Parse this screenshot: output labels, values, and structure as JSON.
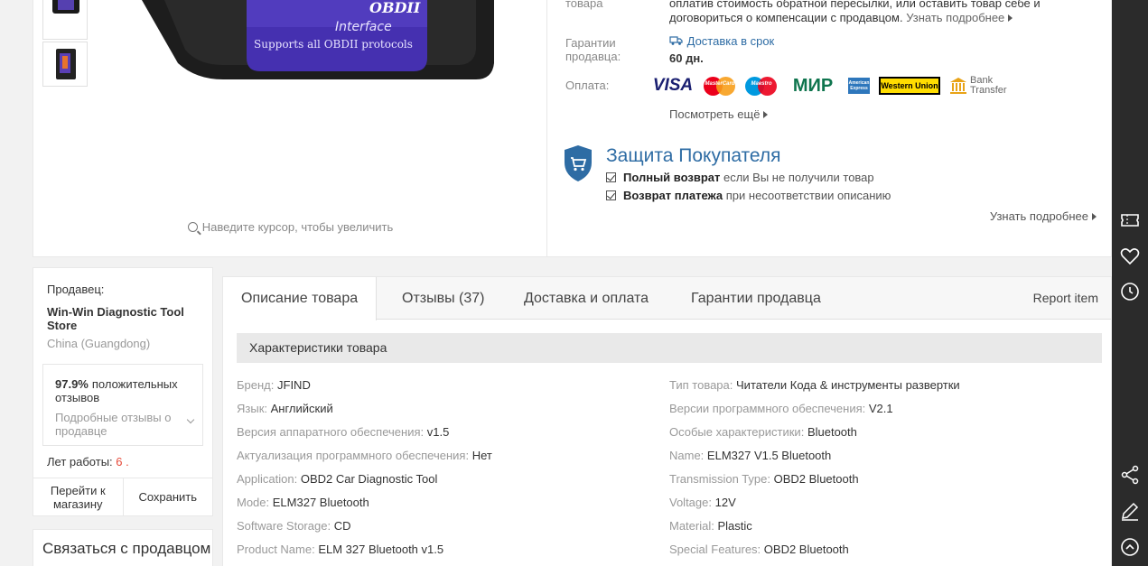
{
  "gallery": {
    "product_image_text_top": "OBDII",
    "product_image_text_mid": "Interface",
    "product_image_text_bottom": "Supports all OBDII protocols",
    "zoom_hint": "Наведите курсор, чтобы увеличить"
  },
  "info": {
    "return_label": "товара",
    "return_text_1": "оплатив стоимость обратной пересылки, или оставить товар себе и",
    "return_text_2": "договориться о компенсации с продавцом.",
    "return_more": "Узнать подробнее",
    "guarantee_label": "Гарантии продавца:",
    "guarantee_delivery": "Доставка в срок",
    "guarantee_days": "60 дн.",
    "payment_label": "Оплата:",
    "payment_methods": [
      "VISA",
      "MasterCard",
      "Maestro",
      "МИР",
      "American Express",
      "Western Union",
      "Bank Transfer"
    ],
    "payment_more": "Посмотреть ещё"
  },
  "protection": {
    "title": "Защита Покупателя",
    "line1_bold": "Полный возврат",
    "line1_rest": "если Вы не получили товар",
    "line2_bold": "Возврат платежа",
    "line2_rest": "при несоответствии описанию",
    "learn_more": "Узнать подробнее"
  },
  "seller": {
    "label": "Продавец:",
    "name": "Win-Win Diagnostic Tool Store",
    "location": "China (Guangdong)",
    "feedback_pct": "97.9%",
    "feedback_text": "положительных отзывов",
    "feedback_details": "Подробные отзывы о продавце",
    "years_label": "Лет работы:",
    "years_value": "6",
    "years_suffix": ".",
    "go_store": "Перейти к магазину",
    "save": "Сохранить",
    "contact": "Связаться с продавцом"
  },
  "tabs": {
    "description": "Описание товара",
    "reviews": "Отзывы (37)",
    "shipping": "Доставка и оплата",
    "guarantees": "Гарантии продавца",
    "report": "Report item"
  },
  "specs": {
    "header": "Характеристики товара",
    "left": [
      {
        "k": "Бренд:",
        "v": "JFIND"
      },
      {
        "k": "Язык:",
        "v": "Английский"
      },
      {
        "k": "Версия аппаратного обеспечения:",
        "v": "v1.5"
      },
      {
        "k": "Актуализация программного обеспечения:",
        "v": "Нет"
      },
      {
        "k": "Application:",
        "v": "OBD2 Car Diagnostic Tool"
      },
      {
        "k": "Mode:",
        "v": "ELM327 Bluetooth"
      },
      {
        "k": "Software Storage:",
        "v": "CD"
      },
      {
        "k": "Product Name:",
        "v": "ELM 327 Bluetooth v1.5"
      }
    ],
    "right": [
      {
        "k": "Тип товара:",
        "v": "Читатели Кода & инструменты развертки"
      },
      {
        "k": "Версии программного обеспечения:",
        "v": "V2.1"
      },
      {
        "k": "Особые характеристики:",
        "v": "Bluetooth"
      },
      {
        "k": "Name:",
        "v": "ELM327 V1.5 Bluetooth"
      },
      {
        "k": "Transmission Type:",
        "v": "OBD2 Bluetooth"
      },
      {
        "k": "Voltage:",
        "v": "12V"
      },
      {
        "k": "Material:",
        "v": "Plastic"
      },
      {
        "k": "Special Features:",
        "v": "OBD2 Bluetooth"
      }
    ]
  },
  "toolbar": {
    "icons": [
      "coupon-icon",
      "heart-icon",
      "history-icon",
      "share-icon",
      "edit-icon",
      "scroll-top-icon"
    ]
  },
  "colors": {
    "accent_blue": "#2e6ca4",
    "years_red": "#e64b3b",
    "toolbar_bg": "#2b2b2b"
  }
}
